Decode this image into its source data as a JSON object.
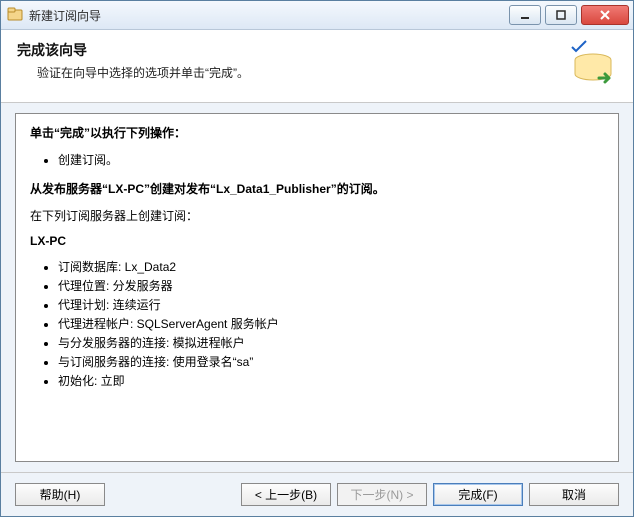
{
  "titlebar": {
    "title": "新建订阅向导"
  },
  "header": {
    "heading": "完成该向导",
    "subtitle": "验证在向导中选择的选项并单击“完成”。"
  },
  "content": {
    "line_execute": "单击“完成”以执行下列操作：",
    "action_item": "创建订阅。",
    "from_publisher": "从发布服务器“LX-PC”创建对发布“Lx_Data1_Publisher”的订阅。",
    "on_subscribers": "在下列订阅服务器上创建订阅：",
    "subscriber_name": "LX-PC",
    "details": [
      "订阅数据库: Lx_Data2",
      "代理位置: 分发服务器",
      "代理计划: 连续运行",
      "代理进程帐户: SQLServerAgent 服务帐户",
      "与分发服务器的连接: 模拟进程帐户",
      "与订阅服务器的连接: 使用登录名“sa”",
      "初始化: 立即"
    ]
  },
  "buttons": {
    "help": "帮助(H)",
    "back": "< 上一步(B)",
    "next": "下一步(N) >",
    "finish": "完成(F)",
    "cancel": "取消"
  }
}
